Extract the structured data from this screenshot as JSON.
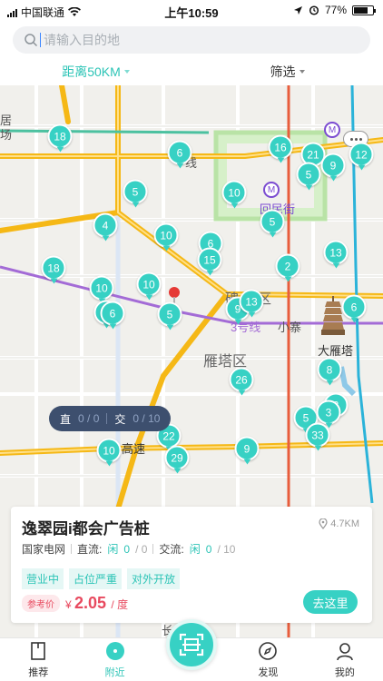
{
  "status": {
    "carrier": "中国联通",
    "time": "上午10:59",
    "battery": "77%",
    "battery_level": 0.77
  },
  "search": {
    "placeholder": "请输入目的地"
  },
  "filters": {
    "distance": "距离50KM",
    "filter": "筛选"
  },
  "map": {
    "labels": {
      "district": "雁塔区",
      "district_partial": "碑",
      "district_partial2": "区",
      "huimin": "回民街",
      "pagoda": "大雁塔",
      "line3": "3号线",
      "xiaozhai": "小寨",
      "gaosu": "高速",
      "ju": "居",
      "chang": "场",
      "xian": "线",
      "chang2": "长"
    },
    "pins": [
      "18",
      "6",
      "16",
      "21",
      "12",
      "9",
      "5",
      "10",
      "5",
      "4",
      "10",
      "5",
      "6",
      "15",
      "13",
      "18",
      "10",
      "10",
      "2",
      "6",
      "6",
      "5",
      "9",
      "13",
      "6",
      "8",
      "26",
      "5",
      "2",
      "3",
      "33",
      "22",
      "10",
      "29",
      "9"
    ],
    "legend": {
      "zhi": "直",
      "zhi_value": "0 / 0",
      "jiao": "交",
      "jiao_value": "0 / 10"
    },
    "metro_icon": "metro-icon",
    "colors": {
      "pin": "#37d1c4",
      "road_major": "#f5b816",
      "metro_line": "#a36bd6"
    }
  },
  "card": {
    "title": "逸翠园i都会广告桩",
    "distance": "4.7KM",
    "operator": "国家电网",
    "dc_label": "直流:",
    "dc_status": "闲",
    "dc_free": "0",
    "dc_total": "/ 0",
    "ac_label": "交流:",
    "ac_status": "闲",
    "ac_free": "0",
    "ac_total": "/ 10",
    "tags": [
      "营业中",
      "占位严重",
      "对外开放"
    ],
    "ref_label": "参考价",
    "price_symbol": "¥",
    "price": "2.05",
    "price_unit": "/ 度",
    "goto_label": "去这里"
  },
  "tabs": [
    {
      "label": "推荐",
      "icon": "bookmark-icon"
    },
    {
      "label": "附近",
      "icon": "nearby-dot-icon"
    },
    {
      "label": "扫码",
      "icon": "scan-icon"
    },
    {
      "label": "发现",
      "icon": "compass-icon"
    },
    {
      "label": "我的",
      "icon": "person-icon"
    }
  ]
}
